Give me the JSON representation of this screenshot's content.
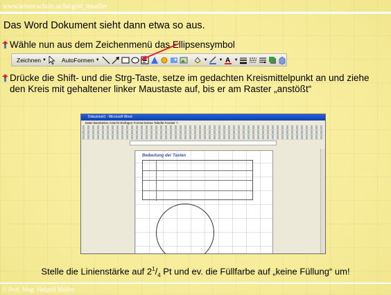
{
  "header": {
    "url": "www.lehrer.schule.at/helgrid_mueller"
  },
  "intro": "Das Word Dokument sieht dann etwa so aus.",
  "bullets": [
    {
      "text": "Wähle nun aus dem Zeichenmenü das Ellipsensymbol"
    },
    {
      "text": "Drücke die Shift- und die Strg-Taste, setze im gedachten Kreismittelpunkt an und ziehe den Kreis mit gehaltener linker Maustaste auf, bis er am Raster „anstößt“"
    }
  ],
  "toolbar": {
    "draw_label": "Zeichnen",
    "autoshapes_label": "AutoFormen",
    "icons": [
      "select-pointer-icon",
      "line-icon",
      "arrow-icon",
      "rectangle-icon",
      "ellipse-icon",
      "textbox-icon",
      "wordart-icon",
      "diagram-icon",
      "clipart-icon",
      "picture-icon",
      "fill-color-icon",
      "line-color-icon",
      "font-color-icon",
      "line-style-icon",
      "dash-style-icon",
      "arrow-style-icon",
      "shadow-icon",
      "3d-icon"
    ]
  },
  "screenshot": {
    "title": "Dokument1 - Microsoft Word",
    "menu": "Datei  Bearbeiten  Ansicht  Einfügen  Format  Extras  Tabelle  Fenster  ?",
    "page_heading": "Bedeutung der Tasten"
  },
  "bottom": {
    "text_pre": "Stelle die Linienstärke auf 2",
    "sup": "1",
    "slash": "/",
    "sub": "4",
    "text_post": " Pt und ev. die Füllfarbe auf „keine Füllung“ um!"
  },
  "footer": {
    "copyright": "© Prof. Mag. Helgrid Müller"
  },
  "colors": {
    "background": "#f6efa0",
    "arrow": "#e0202a",
    "accent": "#ffffff"
  }
}
